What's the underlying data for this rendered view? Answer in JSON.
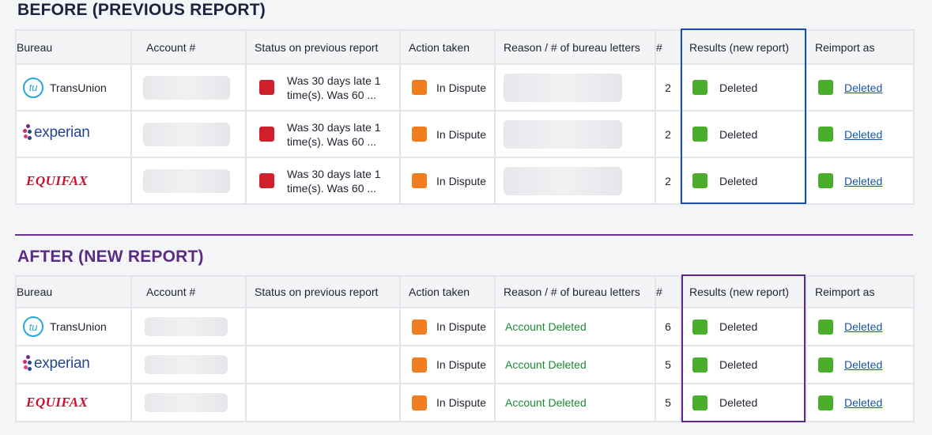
{
  "before": {
    "title": "BEFORE (PREVIOUS REPORT)",
    "headers": {
      "bureau": "Bureau",
      "account": "Account #",
      "status": "Status on previous report",
      "action": "Action taken",
      "reason": "Reason / # of bureau letters",
      "num": "#",
      "results": "Results (new report)",
      "reimport": "Reimport as"
    },
    "rows": [
      {
        "bureau": "TransUnion",
        "status_line1": "Was 30 days late 1",
        "status_line2": "time(s). Was 60 ...",
        "action": "In Dispute",
        "count": "2",
        "result": "Deleted",
        "reimport": "Deleted"
      },
      {
        "bureau": "experian",
        "status_line1": "Was 30 days late 1",
        "status_line2": "time(s). Was 60 ...",
        "action": "In Dispute",
        "count": "2",
        "result": "Deleted",
        "reimport": "Deleted"
      },
      {
        "bureau": "EQUIFAX",
        "status_line1": "Was 30 days late 1",
        "status_line2": "time(s). Was 60 ...",
        "action": "In Dispute",
        "count": "2",
        "result": "Deleted",
        "reimport": "Deleted"
      }
    ]
  },
  "after": {
    "title": "AFTER (NEW REPORT)",
    "headers": {
      "bureau": "Bureau",
      "account": "Account #",
      "status": "Status on previous report",
      "action": "Action taken",
      "reason": "Reason / # of bureau letters",
      "num": "#",
      "results": "Results (new report)",
      "reimport": "Reimport as"
    },
    "rows": [
      {
        "bureau": "TransUnion",
        "action": "In Dispute",
        "reason": "Account Deleted",
        "count": "6",
        "result": "Deleted",
        "reimport": "Deleted"
      },
      {
        "bureau": "experian",
        "action": "In Dispute",
        "reason": "Account Deleted",
        "count": "5",
        "result": "Deleted",
        "reimport": "Deleted"
      },
      {
        "bureau": "EQUIFAX",
        "action": "In Dispute",
        "reason": "Account Deleted",
        "count": "5",
        "result": "Deleted",
        "reimport": "Deleted"
      }
    ]
  },
  "logos": {
    "transunion_mark": "tu"
  },
  "colors": {
    "status_red": "#d0202c",
    "action_orange": "#f07e1f",
    "result_green": "#4aad2c",
    "before_highlight": "#1e4f9c",
    "after_accent": "#5b2a83",
    "link_blue": "#1a56a8"
  }
}
